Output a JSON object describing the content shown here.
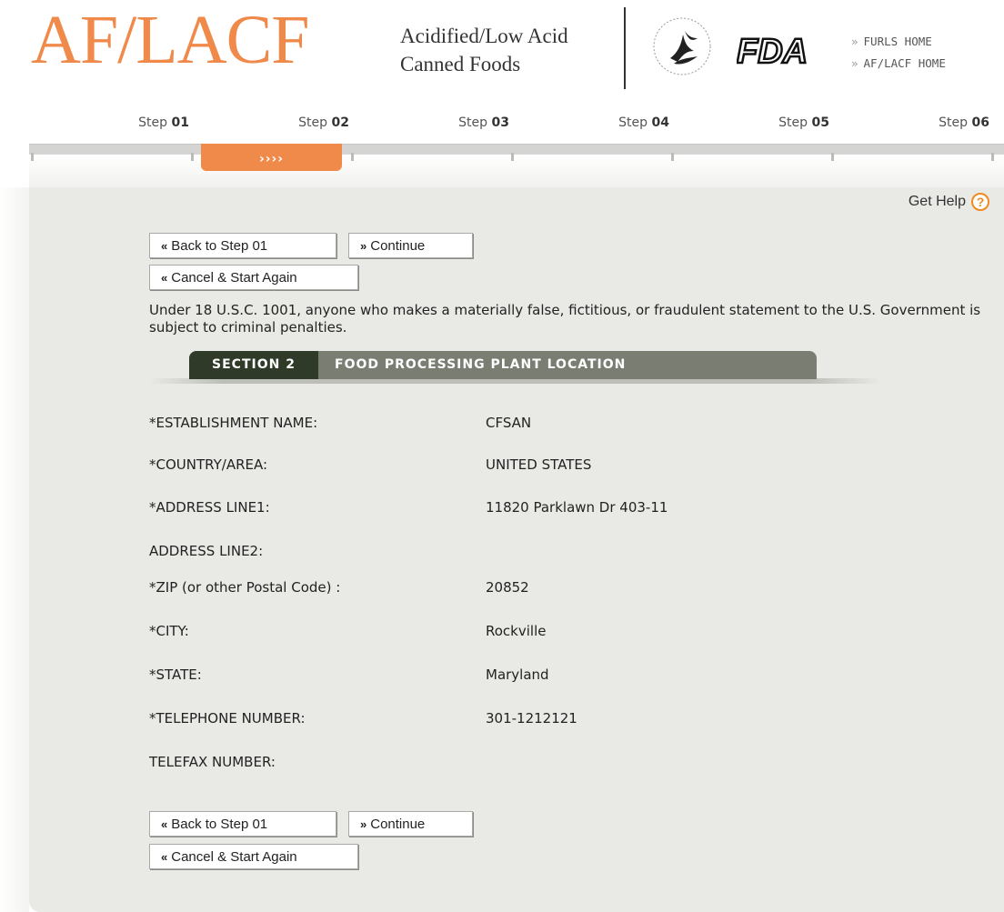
{
  "header": {
    "logo": "AF/LACF",
    "subtitle_line1": "Acidified/Low Acid",
    "subtitle_line2": "Canned Foods",
    "fda_logo_text": "FDA",
    "links": [
      {
        "arrow": "»",
        "label": "FURLS HOME"
      },
      {
        "arrow": "»",
        "label": "AF/LACF HOME"
      }
    ]
  },
  "steps": [
    {
      "prefix": "Step",
      "num": "01"
    },
    {
      "prefix": "Step",
      "num": "02"
    },
    {
      "prefix": "Step",
      "num": "03"
    },
    {
      "prefix": "Step",
      "num": "04"
    },
    {
      "prefix": "Step",
      "num": "05"
    },
    {
      "prefix": "Step",
      "num": "06"
    }
  ],
  "current_step": 2,
  "current_step_marker": "››››",
  "help": {
    "label": "Get Help",
    "icon": "?"
  },
  "buttons": {
    "back": {
      "chev": "«",
      "label": "Back to Step 01"
    },
    "continue": {
      "chev": "»",
      "label": "Continue"
    },
    "cancel": {
      "chev": "«",
      "label": "Cancel & Start Again"
    }
  },
  "warning": "Under 18 U.S.C. 1001, anyone who makes a materially false, fictitious, or fraudulent statement to the U.S. Government is subject to criminal penalties.",
  "section": {
    "number_label": "SECTION 2",
    "title": "FOOD PROCESSING PLANT LOCATION"
  },
  "fields": [
    {
      "label": "*ESTABLISHMENT NAME:",
      "value": "CFSAN"
    },
    {
      "label": "*COUNTRY/AREA:",
      "value": "UNITED STATES"
    },
    {
      "label": "*ADDRESS LINE1:",
      "value": "11820 Parklawn Dr 403-11"
    },
    {
      "label": "ADDRESS LINE2:",
      "value": ""
    },
    {
      "label": "*ZIP (or other Postal Code) :",
      "value": "20852"
    },
    {
      "label": "*CITY:",
      "value": "Rockville"
    },
    {
      "label": "*STATE:",
      "value": "Maryland"
    },
    {
      "label": "*TELEPHONE NUMBER:",
      "value": "301-1212121"
    },
    {
      "label": "TELEFAX NUMBER:",
      "value": ""
    }
  ],
  "colors": {
    "accent": "#f08a4b",
    "panel": "#e9e9e5",
    "section_dark": "#2f3a28",
    "section_light": "#7a7d72"
  }
}
